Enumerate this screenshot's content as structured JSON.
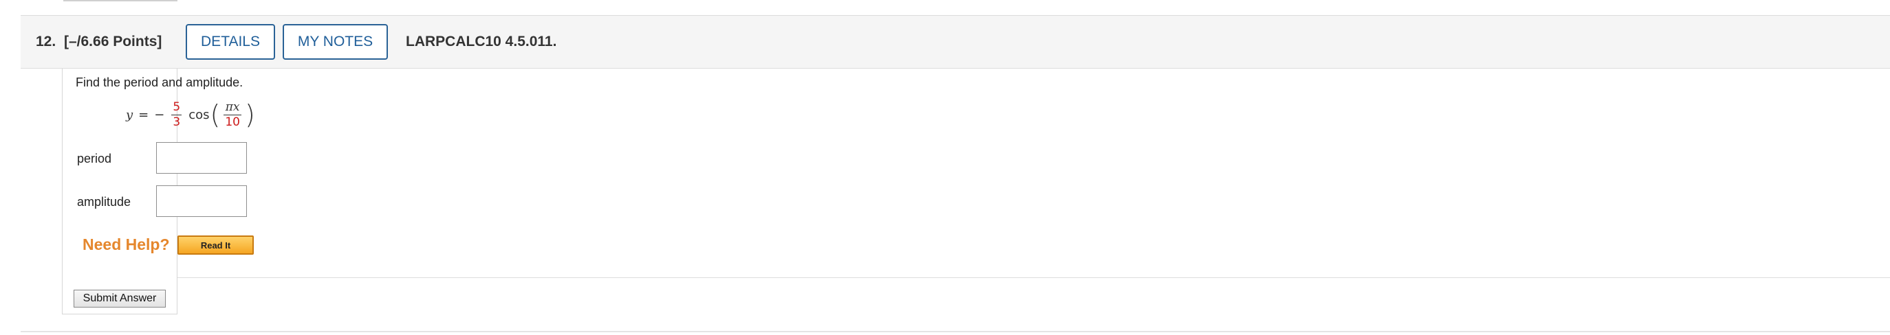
{
  "question": {
    "number": "12.",
    "points": "[–/6.66 Points]",
    "details_label": "DETAILS",
    "my_notes_label": "MY NOTES",
    "code": "LARPCALC10 4.5.011."
  },
  "body": {
    "instruction": "Find the period and amplitude.",
    "equation": {
      "lhs": "y",
      "equals": "=",
      "sign": "−",
      "coef_num": "5",
      "coef_den": "3",
      "func": "cos",
      "arg_num": "πx",
      "arg_den": "10",
      "open_paren": "(",
      "close_paren": ")"
    },
    "fields": [
      {
        "label": "period",
        "value": ""
      },
      {
        "label": "amplitude",
        "value": ""
      }
    ]
  },
  "help": {
    "need_help": "Need Help?",
    "read_it": "Read It"
  },
  "submit_label": "Submit Answer",
  "colors": {
    "accent_blue": "#1f5e99",
    "help_orange": "#e5872d",
    "fraction_red": "#cc1a1a"
  }
}
